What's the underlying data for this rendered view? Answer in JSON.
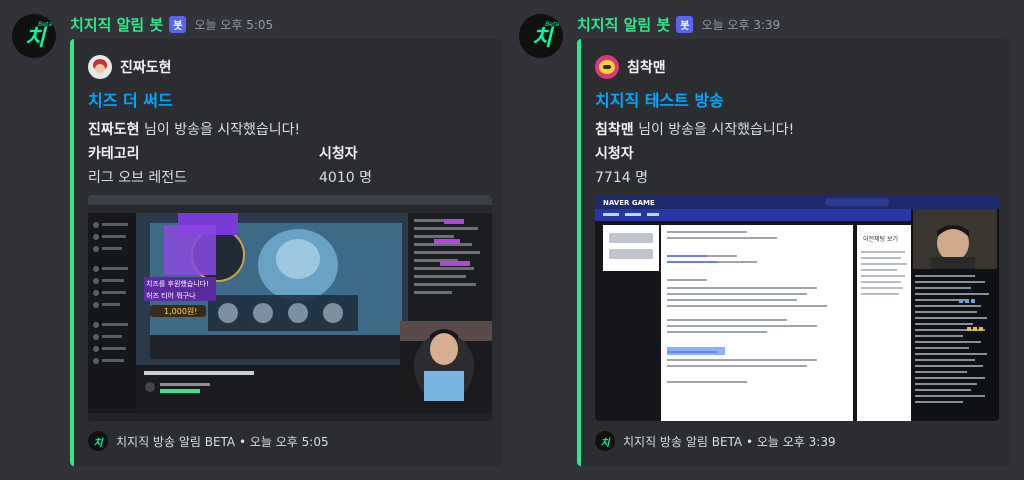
{
  "messages": [
    {
      "bot": {
        "name": "치지직 알림 봇",
        "tag": "봇",
        "timestamp": "오늘 오후 5:05",
        "avatar_icon": "chzzk-logo-icon",
        "avatar_text": "치",
        "avatar_beta": "Beta"
      },
      "embed": {
        "accent_color": "#2ee88a",
        "author": {
          "name": "진짜도현",
          "avatar_icon": "streamer-avatar-icon"
        },
        "title": "치즈 더 써드",
        "description_name": "진짜도현",
        "description_text": " 님이 방송을 시작했습니다!",
        "fields": [
          {
            "name": "카테고리",
            "value": "리그 오브 레전드"
          },
          {
            "name": "시청자",
            "value": "4010 명"
          }
        ],
        "thumbnail": {
          "donation_text": "1,000원!",
          "overlay_lines": [
            "치즈를 후원했습니다!",
            "허즈 티어 뭐구나"
          ]
        },
        "footer": {
          "text": "치지직 방송 알림 BETA • 오늘 오후 5:05",
          "icon": "chzzk-logo-icon"
        }
      }
    },
    {
      "bot": {
        "name": "치지직 알림 봇",
        "tag": "봇",
        "timestamp": "오늘 오후 3:39",
        "avatar_icon": "chzzk-logo-icon",
        "avatar_text": "치",
        "avatar_beta": "Beta"
      },
      "embed": {
        "accent_color": "#2ee88a",
        "author": {
          "name": "침착맨",
          "avatar_icon": "streamer-avatar-icon"
        },
        "title": "치지직 테스트 방송",
        "description_name": "침착맨",
        "description_text": " 님이 방송을 시작했습니다!",
        "fields": [
          {
            "name": "시청자",
            "value": "7714 명"
          }
        ],
        "thumbnail": {
          "brand": "NAVER GAME",
          "chat_title": "이전채팅 보기"
        },
        "footer": {
          "text": "치지직 방송 알림 BETA • 오늘 오후 3:39",
          "icon": "chzzk-logo-icon"
        }
      }
    }
  ]
}
